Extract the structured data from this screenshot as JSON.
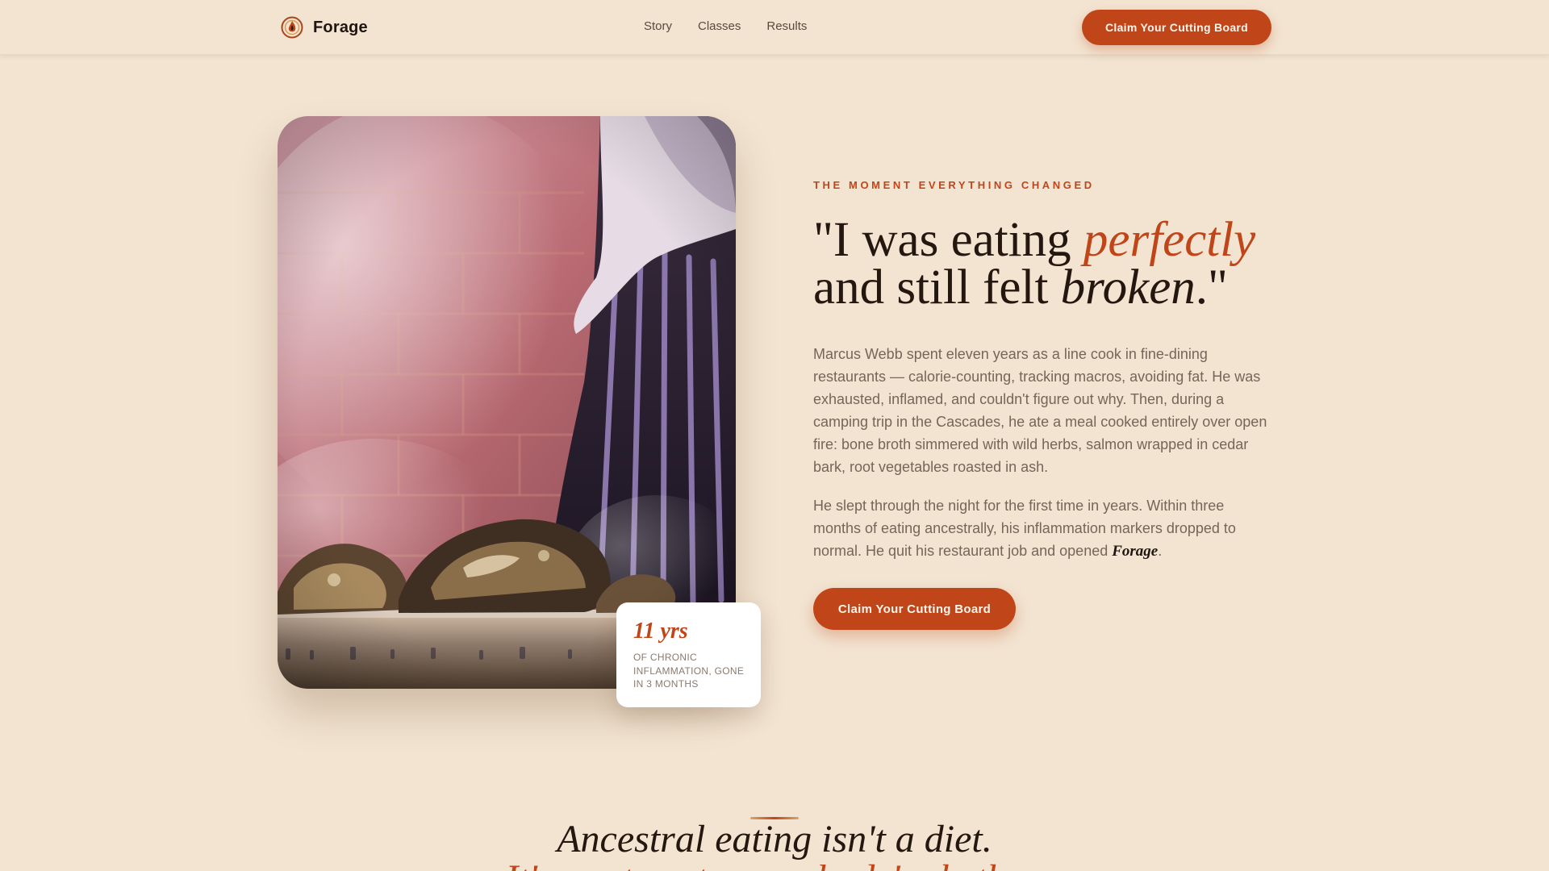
{
  "nav": {
    "brand_name": "Forage",
    "links": [
      "Story",
      "Classes",
      "Results"
    ],
    "cta_label": "Claim Your Cutting Board"
  },
  "hero": {
    "image_icon": "campfire-oysters-photo",
    "stat": {
      "value": "11 yrs",
      "caption": "OF CHRONIC INFLAMMATION, GONE IN 3 MONTHS"
    },
    "eyebrow": "THE MOMENT EVERYTHING CHANGED",
    "headline": {
      "part1": "\"I was eating ",
      "accent": "perfectly",
      "part2": " and still felt ",
      "italic": "broken",
      "part3": ".\""
    },
    "paragraph1": "Marcus Webb spent eleven years as a line cook in fine-dining restaurants — calorie-counting, tracking macros, avoiding fat. He was exhausted, inflamed, and couldn't figure out why. Then, during a camping trip in the Cascades, he ate a meal cooked entirely over open fire: bone broth simmered with wild herbs, salmon wrapped in cedar bark, root vegetables roasted in ash.",
    "paragraph2_before": "He slept through the night for the first time in years. Within three months of eating ancestrally, his inflammation markers dropped to normal. He quit his restaurant job and opened ",
    "paragraph2_brand": "Forage",
    "paragraph2_after": ".",
    "cta_label": "Claim Your Cutting Board"
  },
  "next_section": {
    "heading": "Ancestral eating isn't a diet.",
    "subheading": "It's a return to your body's rhythm."
  },
  "colors": {
    "background": "#f2e4d1",
    "accent": "#c0461a",
    "text_dark": "#231710",
    "text_muted": "#756659"
  }
}
